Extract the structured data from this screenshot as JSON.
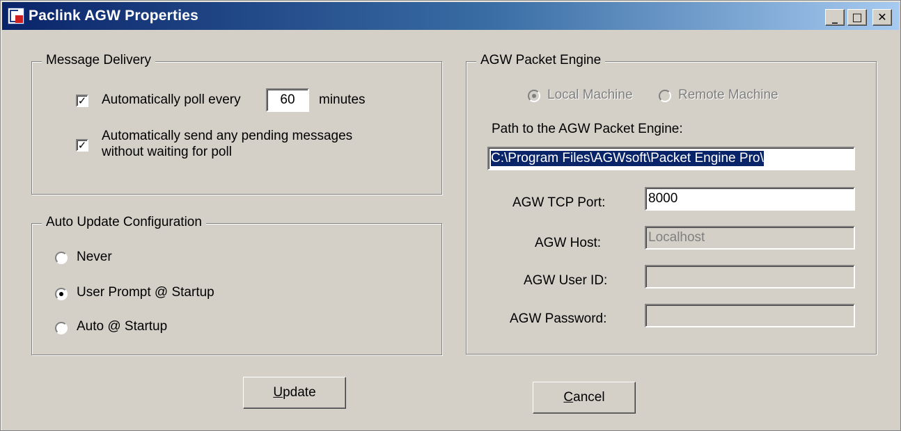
{
  "window": {
    "title": "Paclink AGW Properties",
    "minimize_label": "_",
    "maximize_label": "□",
    "close_label": "✕"
  },
  "message_delivery": {
    "legend": "Message Delivery",
    "auto_poll": {
      "checked": true,
      "check_glyph": "✓",
      "label_prefix": "Automatically poll every",
      "value": "60",
      "label_suffix": "minutes"
    },
    "auto_send": {
      "checked": true,
      "check_glyph": "✓",
      "line1": "Automatically send any pending messages",
      "line2": "without waiting for poll"
    }
  },
  "auto_update": {
    "legend": "Auto Update Configuration",
    "options": [
      {
        "label": "Never",
        "selected": false
      },
      {
        "label": "User Prompt @ Startup",
        "selected": true
      },
      {
        "label": "Auto @ Startup",
        "selected": false
      }
    ]
  },
  "agw_engine": {
    "legend": "AGW Packet Engine",
    "location_options": [
      {
        "label": "Local Machine",
        "selected": true,
        "disabled": true
      },
      {
        "label": "Remote Machine",
        "selected": false,
        "disabled": true
      }
    ],
    "path_label": "Path to the AGW Packet Engine:",
    "path_value": "C:\\Program Files\\AGWsoft\\Packet Engine Pro\\",
    "tcp_port_label": "AGW TCP Port:",
    "tcp_port_value": "8000",
    "host_label": "AGW Host:",
    "host_value": "Localhost",
    "user_id_label": "AGW User ID:",
    "user_id_value": "",
    "password_label": "AGW Password:",
    "password_value": ""
  },
  "buttons": {
    "update": {
      "mnemonic": "U",
      "rest": "pdate"
    },
    "cancel": {
      "mnemonic": "C",
      "rest": "ancel"
    }
  },
  "colors": {
    "titlebar_start": "#0a246a",
    "titlebar_end": "#a6caf0",
    "face": "#d4d0c8",
    "selection": "#0a246a"
  }
}
